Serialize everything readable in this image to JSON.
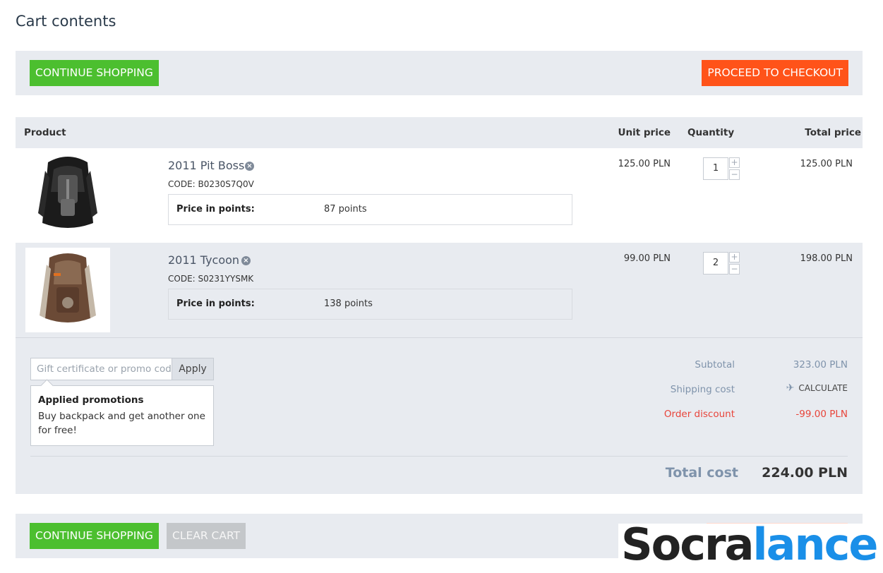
{
  "page": {
    "title": "Cart contents"
  },
  "top_bar": {
    "continue_label": "CONTINUE SHOPPING",
    "checkout_label": "PROCEED TO CHECKOUT"
  },
  "table": {
    "headers": {
      "product": "Product",
      "unit_price": "Unit price",
      "quantity": "Quantity",
      "total_price": "Total price"
    },
    "items": [
      {
        "name": "2011 Pit Boss",
        "code": "CODE: B0230S7Q0V",
        "points_label": "Price in points:",
        "points": "87 points",
        "unit_price": "125.00 PLN",
        "quantity": "1",
        "total": "125.00 PLN"
      },
      {
        "name": "2011 Tycoon",
        "code": "CODE: S0231YYSMK",
        "points_label": "Price in points:",
        "points": "138 points",
        "unit_price": "99.00 PLN",
        "quantity": "2",
        "total": "198.00 PLN"
      }
    ]
  },
  "promo": {
    "placeholder": "Gift certificate or promo code",
    "apply_label": "Apply",
    "applied_title": "Applied promotions",
    "applied_desc": "Buy backpack and get another one for free!"
  },
  "summary": {
    "subtotal_label": "Subtotal",
    "subtotal_value": "323.00 PLN",
    "shipping_label": "Shipping cost",
    "shipping_value": "CALCULATE",
    "discount_label": "Order discount",
    "discount_value": "-99.00 PLN",
    "total_label": "Total cost",
    "total_value": "224.00 PLN"
  },
  "bottom_bar": {
    "continue_label": "CONTINUE SHOPPING",
    "clear_label": "CLEAR CART"
  },
  "watermark": {
    "part1": "Socra",
    "part2": "lance"
  },
  "colors": {
    "green": "#4cbf2f",
    "orange": "#ff5319",
    "panel": "#e8ebf0",
    "discount": "#e8443a",
    "muted": "#7f93ab"
  }
}
